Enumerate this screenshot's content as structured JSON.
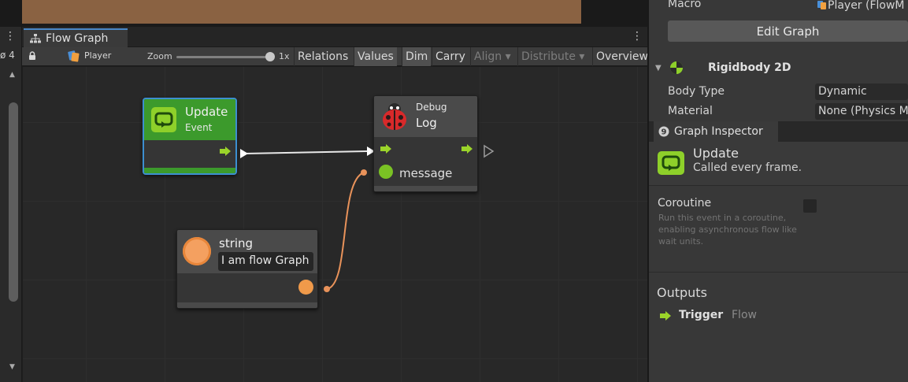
{
  "window": {
    "tab_title": "Flow Graph",
    "left_counter": "ø 4"
  },
  "toolbar": {
    "graph_name": "Player",
    "zoom_label": "Zoom",
    "zoom_value": "1x",
    "zoom_level": 1.0,
    "buttons": [
      {
        "label": "Relations",
        "active": false,
        "enabled": true
      },
      {
        "label": "Values",
        "active": true,
        "enabled": true
      },
      {
        "label": "Dim",
        "active": true,
        "enabled": true
      },
      {
        "label": "Carry",
        "active": false,
        "enabled": true
      },
      {
        "label": "Align ▾",
        "active": false,
        "enabled": false
      },
      {
        "label": "Distribute ▾",
        "active": false,
        "enabled": false
      },
      {
        "label": "Overview",
        "active": false,
        "enabled": true
      }
    ]
  },
  "nodes": {
    "update": {
      "title": "Update",
      "subtitle": "Event"
    },
    "debug": {
      "subtitle": "Debug",
      "title": "Log",
      "port_label": "message"
    },
    "string": {
      "title": "string",
      "value": "I am flow Graph"
    }
  },
  "inspector": {
    "macro_label": "Macro",
    "macro_value": "Player (FlowM",
    "edit_graph_label": "Edit Graph",
    "component_title": "Rigidbody 2D",
    "body_type_label": "Body Type",
    "body_type_value": "Dynamic",
    "material_label": "Material",
    "material_value": "None (Physics M",
    "graph_inspector_tab": "Graph Inspector",
    "selected_title": "Update",
    "selected_desc": "Called every frame.",
    "coroutine_label": "Coroutine",
    "coroutine_help": "Run this event in a coroutine, enabling asynchronous flow like wait units.",
    "coroutine_checked": false,
    "outputs_label": "Outputs",
    "output_name": "Trigger",
    "output_type": "Flow"
  },
  "colors": {
    "accent_blue": "#3c8fd0",
    "event_green": "#3c9a2c",
    "flow_arrow": "#9bd42a",
    "value_orange": "#f09a4a",
    "port_green": "#7ac224"
  }
}
